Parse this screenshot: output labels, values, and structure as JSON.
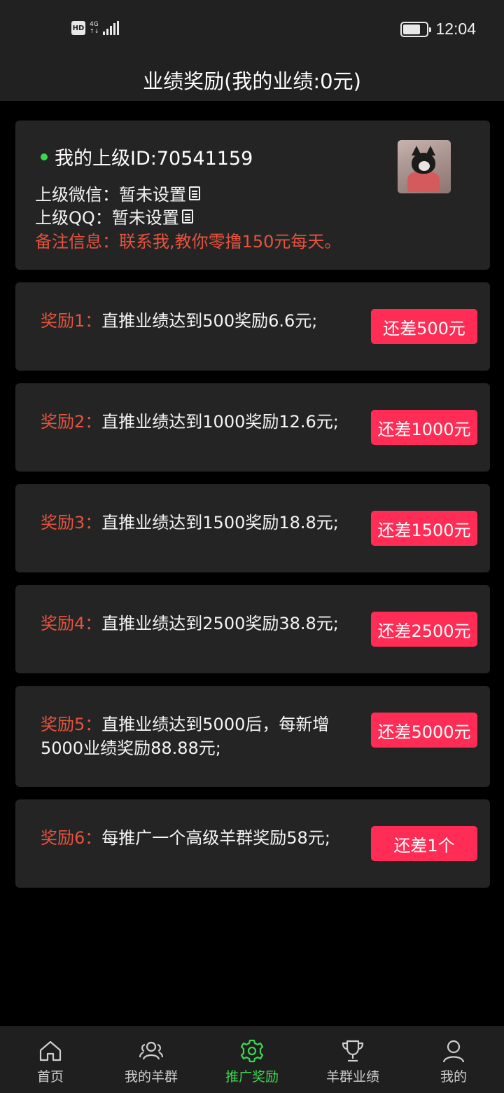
{
  "status_bar": {
    "left_badge": "HD",
    "network": "4G",
    "time": "12:04",
    "battery_level": 0.75
  },
  "header": {
    "title": "业绩奖励(我的业绩:0元)"
  },
  "upline": {
    "id_text": "我的上级ID:70541159",
    "wechat_text": "上级微信：暂未设置",
    "qq_text": "上级QQ：暂未设置",
    "note_text": "备注信息：联系我,教你零撸150元每天。",
    "dot_color": "#3cd650"
  },
  "rewards": [
    {
      "label": "奖励1：",
      "desc": "直推业绩达到500奖励6.6元;",
      "button": "还差500元"
    },
    {
      "label": "奖励2：",
      "desc": "直推业绩达到1000奖励12.6元;",
      "button": "还差1000元"
    },
    {
      "label": "奖励3：",
      "desc": "直推业绩达到1500奖励18.8元;",
      "button": "还差1500元"
    },
    {
      "label": "奖励4：",
      "desc": "直推业绩达到2500奖励38.8元;",
      "button": "还差2500元"
    },
    {
      "label": "奖励5：",
      "desc": "直推业绩达到5000后，每新增5000业绩奖励88.88元;",
      "button": "还差5000元"
    },
    {
      "label": "奖励6：",
      "desc": "每推广一个高级羊群奖励58元;",
      "button": "还差1个"
    }
  ],
  "tabbar": {
    "items": [
      {
        "label": "首页",
        "icon": "home-icon"
      },
      {
        "label": "我的羊群",
        "icon": "group-icon"
      },
      {
        "label": "推广奖励",
        "icon": "gear-icon",
        "active": true
      },
      {
        "label": "羊群业绩",
        "icon": "trophy-icon"
      },
      {
        "label": "我的",
        "icon": "user-icon"
      }
    ]
  },
  "colors": {
    "accent_red": "#ff2d55",
    "label_red": "#e5533f",
    "active_green": "#3cd650",
    "card_bg": "#242424"
  }
}
